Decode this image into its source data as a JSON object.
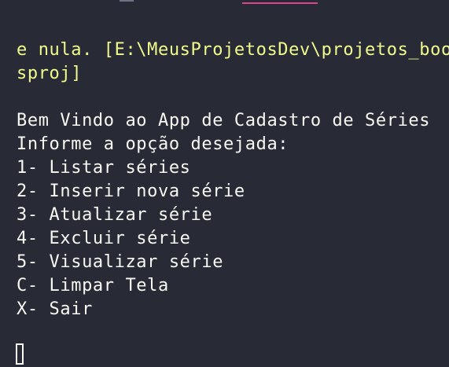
{
  "terminal": {
    "warning": {
      "line1": "e nula. [E:\\MeusProjetosDev\\projetos_bootcamp_dotnet\\DIO.Series\\DIO.Series.csproj]",
      "line2": "sproj]"
    },
    "welcome": "Bem Vindo ao App de Cadastro de Séries",
    "prompt": "Informe a opção desejada:",
    "menu": [
      "1- Listar séries",
      "2- Inserir nova série",
      "3- Atualizar série",
      "4- Excluir série",
      "5- Visualizar série",
      "C- Limpar Tela",
      "X- Sair"
    ]
  },
  "colors": {
    "background": "#282a36",
    "foreground": "#f8f8f2",
    "warning": "#f1fa8c"
  }
}
